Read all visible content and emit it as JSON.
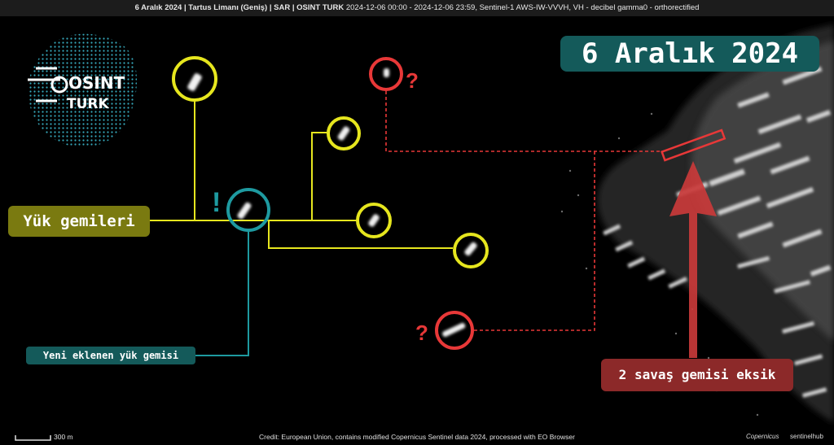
{
  "header": {
    "title_bold": "6 Aralık 2024 | Tartus Limanı (Geniş) | SAR | OSINT TURK",
    "title_rest": " 2024-12-06 00:00 - 2024-12-06 23:59, Sentinel-1 AWS-IW-VVVH, VH - decibel gamma0 - orthorectified"
  },
  "annotations": {
    "date": "6 Aralık 2024",
    "cargo_ships": "Yük gemileri",
    "new_cargo_ship": "Yeni eklenen yük gemisi",
    "missing_warships": "2 savaş gemisi eksik",
    "question_mark": "?",
    "exclamation_mark": "!"
  },
  "logo": {
    "line1": "OSINT",
    "line2": "TURK"
  },
  "footer": {
    "scale": "300 m",
    "credit": "Credit: European Union, contains modified Copernicus Sentinel data 2024, processed with EO Browser",
    "brand_copernicus": "Copernicus",
    "brand_sentinelhub": "sentinelhub"
  },
  "colors": {
    "cargo": "#e6e61e",
    "new_cargo": "#1e9aa0",
    "missing": "#e83838",
    "teal_label": "#145a5a",
    "olive_label": "#7a7a10",
    "red_label": "#8c2929"
  }
}
